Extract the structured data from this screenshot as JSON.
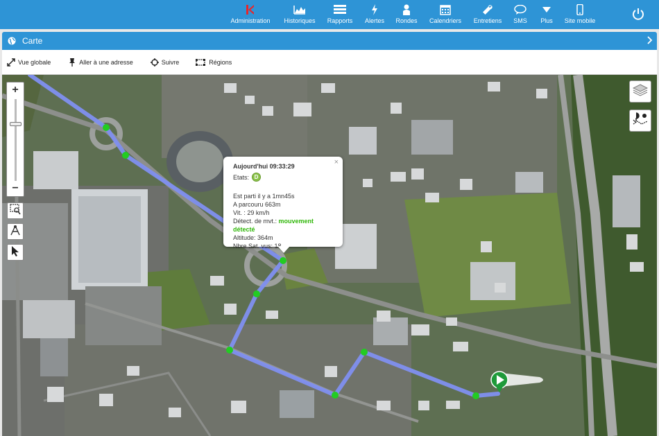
{
  "nav": {
    "items": [
      {
        "label": "Administration",
        "icon": "admin-icon"
      },
      {
        "label": "Historiques",
        "icon": "area-chart-icon"
      },
      {
        "label": "Rapports",
        "icon": "list-icon"
      },
      {
        "label": "Alertes",
        "icon": "bolt-icon"
      },
      {
        "label": "Rondes",
        "icon": "guard-icon"
      },
      {
        "label": "Calendriers",
        "icon": "calendar-icon"
      },
      {
        "label": "Entretiens",
        "icon": "wrench-icon"
      },
      {
        "label": "SMS",
        "icon": "chat-icon"
      },
      {
        "label": "Plus",
        "icon": "caret-down-icon"
      },
      {
        "label": "Site mobile",
        "icon": "mobile-icon"
      }
    ]
  },
  "panel": {
    "title": "Carte"
  },
  "toolbar": {
    "global": "Vue globale",
    "address": "Aller à une adresse",
    "follow": "Suivre",
    "regions": "Régions"
  },
  "popup": {
    "time": "Aujourd'hui 09:33:29",
    "states_label": "Etats:",
    "state_badge": "D",
    "line1": "Est parti il y a 1mn45s",
    "line2": "A parcouru 663m",
    "line3": "Vit. : 29 km/h",
    "line4_label": "Détect. de mvt.: ",
    "line4_value": "mouvement détecté",
    "line5": "Altitude: 364m",
    "line6": "Nbre Sat. vus: 18",
    "close": "×"
  },
  "map": {
    "zoom_in": "+",
    "zoom_out": "−"
  },
  "colors": {
    "brand": "#2e94d6",
    "route": "#7f8ff0",
    "waypoint": "#22cc22",
    "detect": "#31b70a"
  }
}
